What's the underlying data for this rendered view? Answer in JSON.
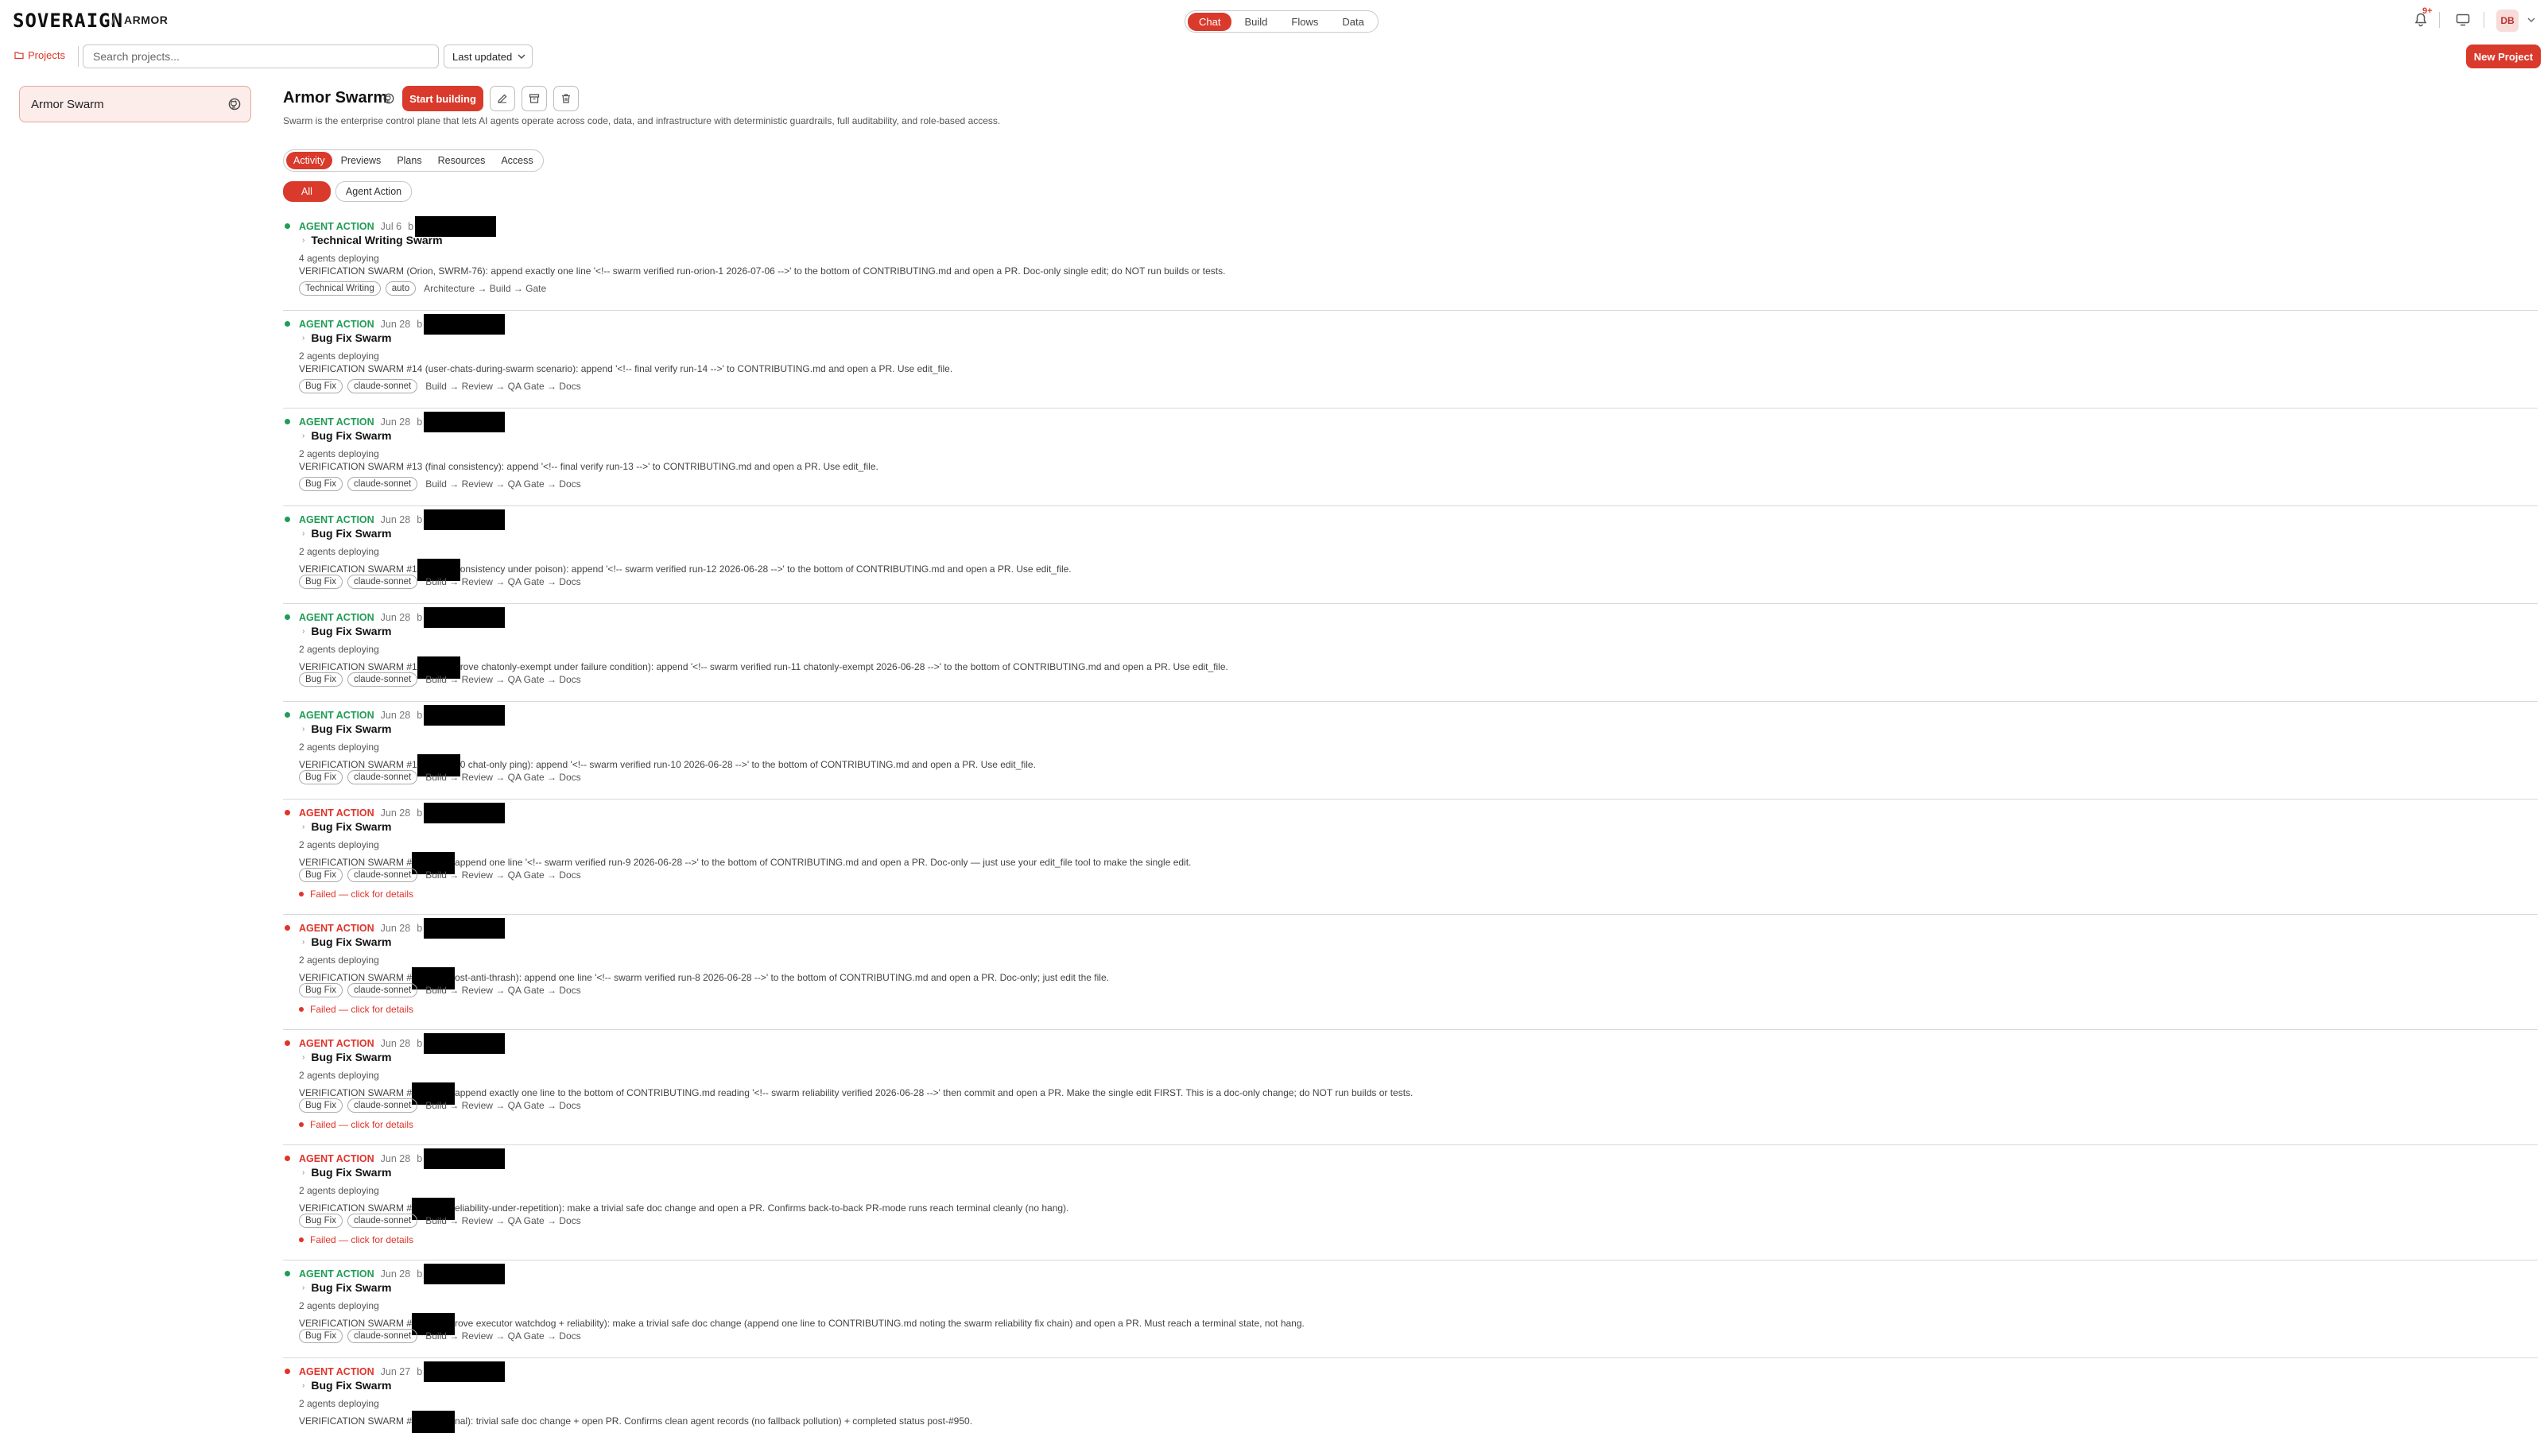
{
  "app": {
    "logo": "SOVERAIGN",
    "breadcrumb": "ARMOR",
    "modes": [
      "Chat",
      "Build",
      "Flows",
      "Data"
    ],
    "active_mode": "Chat",
    "notification_badge": "9+",
    "avatar_initials": "DB",
    "accent_color": "#d93a2b"
  },
  "toolbar": {
    "projects_label": "Projects",
    "search_placeholder": "Search projects...",
    "sort_value": "Last updated",
    "new_project_label": "New Project"
  },
  "sidebar": {
    "projects": [
      {
        "name": "Armor Swarm"
      }
    ]
  },
  "project": {
    "title": "Armor Swarm",
    "start_label": "Start building",
    "description": "Swarm is the enterprise control plane that lets AI agents operate across code, data, and infrastructure with deterministic guardrails, full auditability, and role-based access.",
    "tabs": [
      "Activity",
      "Previews",
      "Plans",
      "Resources",
      "Access"
    ],
    "active_tab": "Activity",
    "filters": [
      "All",
      "Agent Action"
    ],
    "active_filter": "All"
  },
  "activity": [
    {
      "status": "ok",
      "kind": "AGENT ACTION",
      "date": "Jul 6",
      "by": "b",
      "title": "Technical Writing Swarm",
      "agents": "4 agents deploying",
      "desc_pre": "VERIFICATION SWARM (Orion, SWRM-76): append exactly one line '<!-- swarm verified run-orion-1 2026-07-06 -->' to the bottom of CONTRIBUTING.md and open a PR. Doc-only single edit; do NOT run builds or tests.",
      "desc_post": "",
      "chips": [
        "Technical Writing",
        "auto"
      ],
      "pipeline": "Architecture → Build → Gate",
      "failed": ""
    },
    {
      "status": "ok",
      "kind": "AGENT ACTION",
      "date": "Jun 28",
      "by": "b",
      "title": "Bug Fix Swarm",
      "agents": "2 agents deploying",
      "desc_pre": "VERIFICATION SWARM #14 (user-chats-during-swarm scenario): append '<!-- final verify run-14 -->' to CONTRIBUTING.md and open a PR. Use edit_file.",
      "desc_post": "",
      "chips": [
        "Bug Fix",
        "claude-sonnet"
      ],
      "pipeline": "Build → Review → QA Gate → Docs",
      "failed": ""
    },
    {
      "status": "ok",
      "kind": "AGENT ACTION",
      "date": "Jun 28",
      "by": "b",
      "title": "Bug Fix Swarm",
      "agents": "2 agents deploying",
      "desc_pre": "VERIFICATION SWARM #13 (final consistency): append '<!-- final verify run-13 -->' to CONTRIBUTING.md and open a PR. Use edit_file.",
      "desc_post": "",
      "chips": [
        "Bug Fix",
        "claude-sonnet"
      ],
      "pipeline": "Build → Review → QA Gate → Docs",
      "failed": ""
    },
    {
      "status": "ok",
      "kind": "AGENT ACTION",
      "date": "Jun 28",
      "by": "b",
      "title": "Bug Fix Swarm",
      "agents": "2 agents deploying",
      "desc_pre": "VERIFICATION SWARM #1",
      "desc_post": "onsistency under poison): append '<!-- swarm verified run-12 2026-06-28 -->' to the bottom of CONTRIBUTING.md and open a PR. Use edit_file.",
      "chips": [
        "Bug Fix",
        "claude-sonnet"
      ],
      "pipeline": "Build → Review → QA Gate → Docs",
      "failed": ""
    },
    {
      "status": "ok",
      "kind": "AGENT ACTION",
      "date": "Jun 28",
      "by": "b",
      "title": "Bug Fix Swarm",
      "agents": "2 agents deploying",
      "desc_pre": "VERIFICATION SWARM #1",
      "desc_post": "rove chatonly-exempt under failure condition): append '<!-- swarm verified run-11 chatonly-exempt 2026-06-28 -->' to the bottom of CONTRIBUTING.md and open a PR. Use edit_file.",
      "chips": [
        "Bug Fix",
        "claude-sonnet"
      ],
      "pipeline": "Build → Review → QA Gate → Docs",
      "failed": ""
    },
    {
      "status": "ok",
      "kind": "AGENT ACTION",
      "date": "Jun 28",
      "by": "b",
      "title": "Bug Fix Swarm",
      "agents": "2 agents deploying",
      "desc_pre": "VERIFICATION SWARM #1",
      "desc_post": "0 chat-only ping): append '<!-- swarm verified run-10 2026-06-28 -->' to the bottom of CONTRIBUTING.md and open a PR. Use edit_file.",
      "chips": [
        "Bug Fix",
        "claude-sonnet"
      ],
      "pipeline": "Build → Review → QA Gate → Docs",
      "failed": ""
    },
    {
      "status": "fail",
      "kind": "AGENT ACTION",
      "date": "Jun 28",
      "by": "b",
      "title": "Bug Fix Swarm",
      "agents": "2 agents deploying",
      "desc_pre": "VERIFICATION SWARM #",
      "desc_post": "append one line '<!-- swarm verified run-9 2026-06-28 -->' to the bottom of CONTRIBUTING.md and open a PR. Doc-only — just use your edit_file tool to make the single edit.",
      "chips": [
        "Bug Fix",
        "claude-sonnet"
      ],
      "pipeline": "Build → Review → QA Gate → Docs",
      "failed": "Failed — click for details"
    },
    {
      "status": "fail",
      "kind": "AGENT ACTION",
      "date": "Jun 28",
      "by": "b",
      "title": "Bug Fix Swarm",
      "agents": "2 agents deploying",
      "desc_pre": "VERIFICATION SWARM #",
      "desc_post": "ost-anti-thrash): append one line '<!-- swarm verified run-8 2026-06-28 -->' to the bottom of CONTRIBUTING.md and open a PR. Doc-only; just edit the file.",
      "chips": [
        "Bug Fix",
        "claude-sonnet"
      ],
      "pipeline": "Build → Review → QA Gate → Docs",
      "failed": "Failed — click for details"
    },
    {
      "status": "fail",
      "kind": "AGENT ACTION",
      "date": "Jun 28",
      "by": "b",
      "title": "Bug Fix Swarm",
      "agents": "2 agents deploying",
      "desc_pre": "VERIFICATION SWARM #",
      "desc_post": "append exactly one line to the bottom of CONTRIBUTING.md reading '<!-- swarm reliability verified 2026-06-28 -->' then commit and open a PR. Make the single edit FIRST. This is a doc-only change; do NOT run builds or tests.",
      "chips": [
        "Bug Fix",
        "claude-sonnet"
      ],
      "pipeline": "Build → Review → QA Gate → Docs",
      "failed": "Failed — click for details"
    },
    {
      "status": "fail",
      "kind": "AGENT ACTION",
      "date": "Jun 28",
      "by": "b",
      "title": "Bug Fix Swarm",
      "agents": "2 agents deploying",
      "desc_pre": "VERIFICATION SWARM #",
      "desc_post": "eliability-under-repetition): make a trivial safe doc change and open a PR. Confirms back-to-back PR-mode runs reach terminal cleanly (no hang).",
      "chips": [
        "Bug Fix",
        "claude-sonnet"
      ],
      "pipeline": "Build → Review → QA Gate → Docs",
      "failed": "Failed — click for details"
    },
    {
      "status": "ok",
      "kind": "AGENT ACTION",
      "date": "Jun 28",
      "by": "b",
      "title": "Bug Fix Swarm",
      "agents": "2 agents deploying",
      "desc_pre": "VERIFICATION SWARM #",
      "desc_post": "rove executor watchdog + reliability): make a trivial safe doc change (append one line to CONTRIBUTING.md noting the swarm reliability fix chain) and open a PR. Must reach a terminal state, not hang.",
      "chips": [
        "Bug Fix",
        "claude-sonnet"
      ],
      "pipeline": "Build → Review → QA Gate → Docs",
      "failed": ""
    },
    {
      "status": "fail",
      "kind": "AGENT ACTION",
      "date": "Jun 27",
      "by": "b",
      "title": "Bug Fix Swarm",
      "agents": "2 agents deploying",
      "desc_pre": "VERIFICATION SWARM #",
      "desc_post": "nal): trivial safe doc change + open PR. Confirms clean agent records (no fallback pollution) + completed status post-#950.",
      "chips": [],
      "pipeline": "",
      "failed": ""
    }
  ]
}
